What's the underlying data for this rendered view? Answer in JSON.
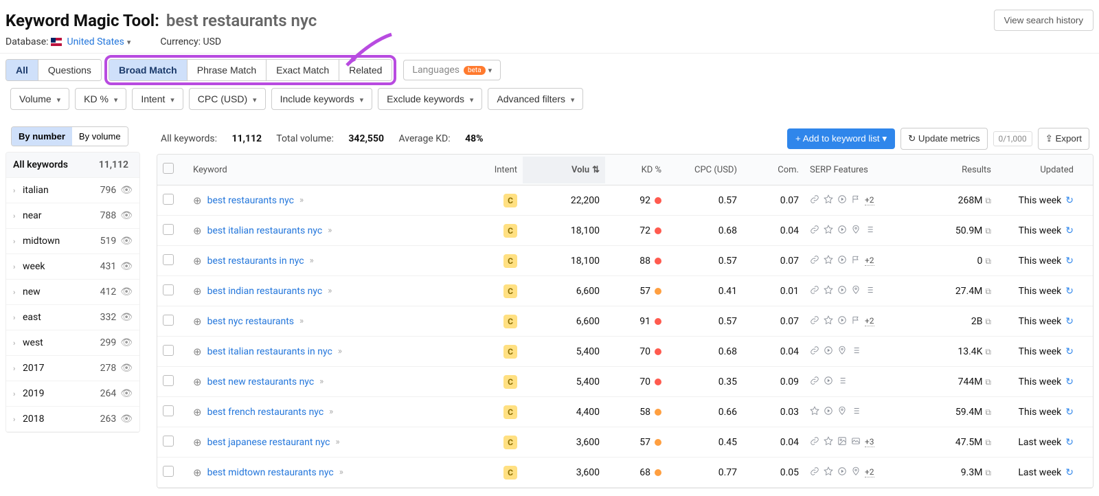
{
  "header": {
    "title_prefix": "Keyword Magic Tool:",
    "query": "best restaurants nyc",
    "history_btn": "View search history",
    "database_label": "Database:",
    "database_value": "United States",
    "currency_label": "Currency:",
    "currency_value": "USD"
  },
  "tabs": {
    "group1": [
      "All",
      "Questions"
    ],
    "group1_active": 0,
    "group2": [
      "Broad Match",
      "Phrase Match",
      "Exact Match",
      "Related"
    ],
    "group2_active": 0,
    "languages": "Languages",
    "beta": "beta"
  },
  "filters": [
    "Volume",
    "KD %",
    "Intent",
    "CPC (USD)",
    "Include keywords",
    "Exclude keywords",
    "Advanced filters"
  ],
  "sidebar": {
    "toggle": [
      "By number",
      "By volume"
    ],
    "toggle_active": 0,
    "all_label": "All keywords",
    "all_count": "11,112",
    "items": [
      {
        "label": "italian",
        "count": "796"
      },
      {
        "label": "near",
        "count": "788"
      },
      {
        "label": "midtown",
        "count": "519"
      },
      {
        "label": "week",
        "count": "431"
      },
      {
        "label": "new",
        "count": "412"
      },
      {
        "label": "east",
        "count": "332"
      },
      {
        "label": "west",
        "count": "299"
      },
      {
        "label": "2017",
        "count": "278"
      },
      {
        "label": "2019",
        "count": "264"
      },
      {
        "label": "2018",
        "count": "263"
      }
    ]
  },
  "stats": {
    "all_keywords_label": "All keywords:",
    "all_keywords_value": "11,112",
    "total_volume_label": "Total volume:",
    "total_volume_value": "342,550",
    "avg_kd_label": "Average KD:",
    "avg_kd_value": "48%",
    "add_btn": "Add to keyword list",
    "update_btn": "Update metrics",
    "counter": "0/1,000",
    "export_btn": "Export"
  },
  "columns": {
    "keyword": "Keyword",
    "intent": "Intent",
    "volume": "Volu",
    "kd": "KD %",
    "cpc": "CPC (USD)",
    "com": "Com.",
    "serp": "SERP Features",
    "results": "Results",
    "updated": "Updated"
  },
  "rows": [
    {
      "keyword": "best restaurants nyc",
      "intent": "C",
      "volume": "22,200",
      "kd": "92",
      "kd_color": "red",
      "cpc": "0.57",
      "com": "0.07",
      "serp": [
        "link",
        "star",
        "video",
        "flag"
      ],
      "serp_plus": "+2",
      "results": "268M",
      "updated": "This week"
    },
    {
      "keyword": "best italian restaurants nyc",
      "intent": "C",
      "volume": "18,100",
      "kd": "72",
      "kd_color": "red",
      "cpc": "0.68",
      "com": "0.04",
      "serp": [
        "link",
        "star",
        "video",
        "pin",
        "list"
      ],
      "serp_plus": "",
      "results": "50.9M",
      "updated": "This week"
    },
    {
      "keyword": "best restaurants in nyc",
      "intent": "C",
      "volume": "18,100",
      "kd": "88",
      "kd_color": "red",
      "cpc": "0.57",
      "com": "0.07",
      "serp": [
        "link",
        "star",
        "video",
        "flag"
      ],
      "serp_plus": "+2",
      "results": "0",
      "updated": "This week"
    },
    {
      "keyword": "best indian restaurants nyc",
      "intent": "C",
      "volume": "6,600",
      "kd": "57",
      "kd_color": "orange",
      "cpc": "0.41",
      "com": "0.01",
      "serp": [
        "link",
        "star",
        "video",
        "pin",
        "list"
      ],
      "serp_plus": "",
      "results": "27.4M",
      "updated": "This week"
    },
    {
      "keyword": "best nyc restaurants",
      "intent": "C",
      "volume": "6,600",
      "kd": "91",
      "kd_color": "red",
      "cpc": "0.57",
      "com": "0.07",
      "serp": [
        "link",
        "star",
        "video",
        "flag"
      ],
      "serp_plus": "+2",
      "results": "2B",
      "updated": "This week"
    },
    {
      "keyword": "best italian restaurants in nyc",
      "intent": "C",
      "volume": "5,400",
      "kd": "70",
      "kd_color": "red",
      "cpc": "0.68",
      "com": "0.04",
      "serp": [
        "link",
        "video",
        "pin",
        "list"
      ],
      "serp_plus": "",
      "results": "13.4K",
      "updated": "This week"
    },
    {
      "keyword": "best new restaurants nyc",
      "intent": "C",
      "volume": "5,400",
      "kd": "70",
      "kd_color": "red",
      "cpc": "0.35",
      "com": "0.09",
      "serp": [
        "link",
        "video",
        "list"
      ],
      "serp_plus": "",
      "results": "744M",
      "updated": "This week"
    },
    {
      "keyword": "best french restaurants nyc",
      "intent": "C",
      "volume": "4,400",
      "kd": "58",
      "kd_color": "orange",
      "cpc": "0.66",
      "com": "0.03",
      "serp": [
        "star",
        "video",
        "pin",
        "list"
      ],
      "serp_plus": "",
      "results": "59.4M",
      "updated": "This week"
    },
    {
      "keyword": "best japanese restaurant nyc",
      "intent": "C",
      "volume": "3,600",
      "kd": "57",
      "kd_color": "orange",
      "cpc": "0.45",
      "com": "0.04",
      "serp": [
        "link",
        "star",
        "image",
        "image2"
      ],
      "serp_plus": "+3",
      "results": "47.5M",
      "updated": "Last week"
    },
    {
      "keyword": "best midtown restaurants nyc",
      "intent": "C",
      "volume": "3,600",
      "kd": "68",
      "kd_color": "orange",
      "cpc": "0.77",
      "com": "0.05",
      "serp": [
        "link",
        "star",
        "video",
        "pin"
      ],
      "serp_plus": "+2",
      "results": "9.3M",
      "updated": "Last week"
    }
  ]
}
